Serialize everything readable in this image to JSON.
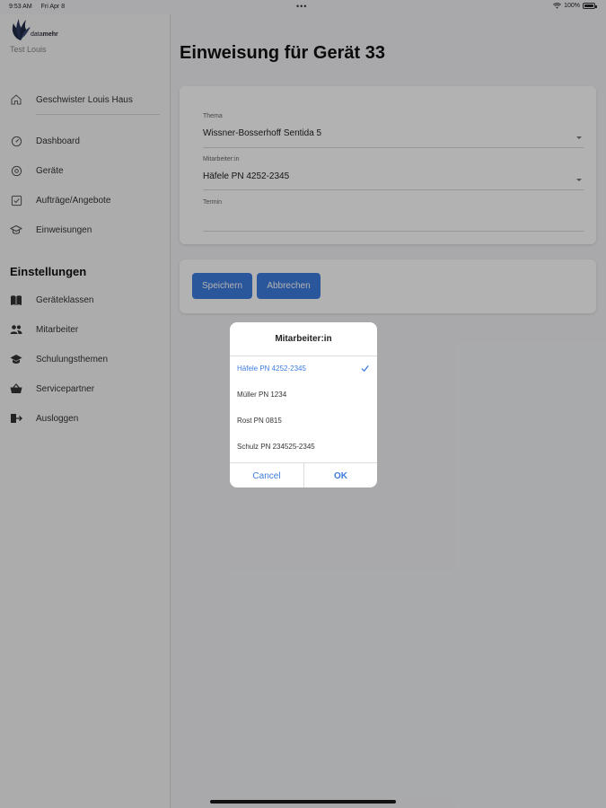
{
  "status_bar": {
    "time": "9:53 AM",
    "date": "Fri Apr 8",
    "dots": "•••",
    "battery": "100%"
  },
  "sidebar": {
    "logo_text_light": "data",
    "logo_text_bold": "mehr",
    "user": "Test Louis",
    "location": "Geschwister Louis Haus",
    "items": [
      {
        "label": "Dashboard",
        "icon": "dashboard-icon"
      },
      {
        "label": "Geräte",
        "icon": "device-icon"
      },
      {
        "label": "Aufträge/Angebote",
        "icon": "checkbox-icon"
      },
      {
        "label": "Einweisungen",
        "icon": "graduation-cap-icon"
      }
    ],
    "settings_title": "Einstellungen",
    "settings_items": [
      {
        "label": "Geräteklassen",
        "icon": "book-icon"
      },
      {
        "label": "Mitarbeiter",
        "icon": "users-icon"
      },
      {
        "label": "Schulungsthemen",
        "icon": "school-icon"
      },
      {
        "label": "Servicepartner",
        "icon": "basket-icon"
      },
      {
        "label": "Ausloggen",
        "icon": "logout-icon"
      }
    ]
  },
  "main": {
    "title": "Einweisung für Gerät 33",
    "form": {
      "thema_label": "Thema",
      "thema_value": "Wissner-Bosserhoff Sentida 5",
      "mitarbeiter_label": "Mitarbeiter:in",
      "mitarbeiter_value": "Häfele PN 4252-2345",
      "termin_label": "Termin",
      "termin_value": ""
    },
    "buttons": {
      "save": "Speichern",
      "cancel": "Abbrechen"
    }
  },
  "picker": {
    "title": "Mitarbeiter:in",
    "options": [
      {
        "label": "Häfele PN 4252-2345",
        "selected": true
      },
      {
        "label": "Müller PN 1234",
        "selected": false
      },
      {
        "label": "Rost PN 0815",
        "selected": false
      },
      {
        "label": "Schulz PN 234525-2345",
        "selected": false
      }
    ],
    "cancel_label": "Cancel",
    "ok_label": "OK"
  },
  "colors": {
    "accent": "#3d7be0",
    "overlay": "rgba(0,0,0,0.30)"
  }
}
